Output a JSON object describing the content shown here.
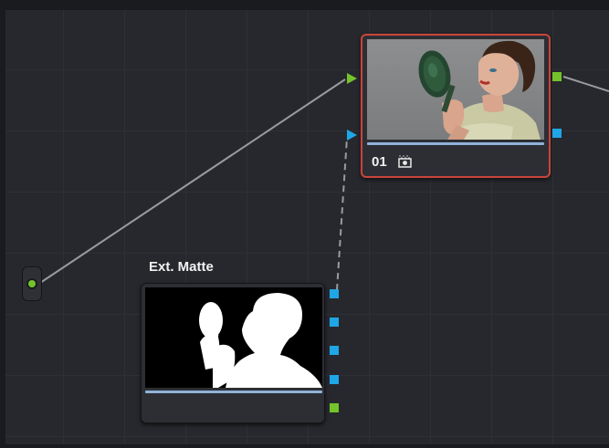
{
  "node_graph": {
    "corrector_node": {
      "number": "01",
      "mode_icon": "matte-mode-icon",
      "selected": true
    },
    "matte_node": {
      "title": "Ext. Matte"
    },
    "source_node": {
      "icon": "source-output-dot-icon"
    },
    "colors": {
      "canvas": "#27282d",
      "rgb_port": "#74c32b",
      "key_port": "#1fa6e6",
      "selection_border": "#c8453c",
      "wire": "#9a9b9f"
    }
  }
}
